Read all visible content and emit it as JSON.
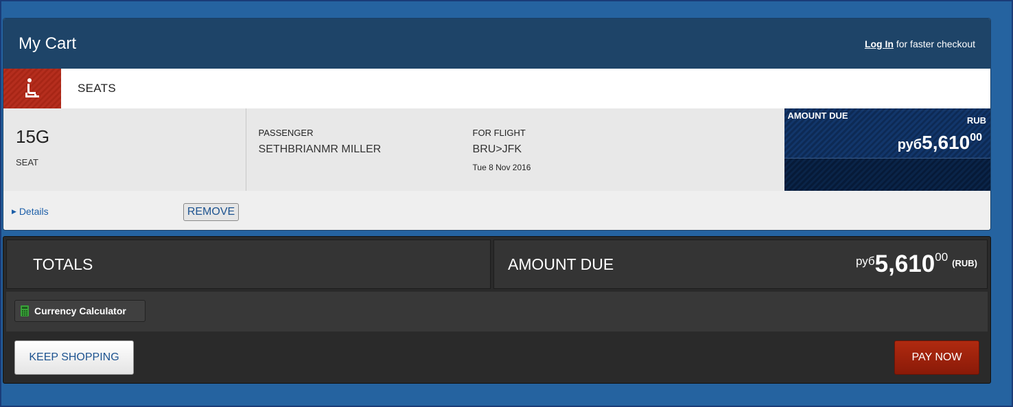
{
  "header": {
    "title": "My Cart",
    "login_link": "Log In",
    "login_suffix": " for faster checkout"
  },
  "section": {
    "icon": "seat-icon",
    "label": "SEATS",
    "accent_color": "#b52e1e"
  },
  "item": {
    "seat_number": "15G",
    "seat_label": "SEAT",
    "passenger_label": "PASSENGER",
    "passenger_name": "SETHBRIANMR MILLER",
    "flight_label": "FOR FLIGHT",
    "flight_route": "BRU>JFK",
    "flight_date": "Tue 8 Nov 2016",
    "amount_label": "AMOUNT DUE",
    "currency_code": "RUB",
    "currency_symbol": "руб",
    "amount_main": "5,610",
    "amount_cents": "00",
    "details_link": "Details",
    "remove_label": "REMOVE"
  },
  "totals": {
    "totals_label": "TOTALS",
    "amount_due_label": "AMOUNT DUE",
    "currency_symbol": "руб",
    "amount_main": "5,610",
    "amount_cents": "00",
    "currency_code": "(RUB)",
    "calculator_label": "Currency Calculator",
    "calculator_icon": "calculator-icon"
  },
  "buttons": {
    "keep_shopping": "KEEP SHOPPING",
    "pay_now": "PAY NOW",
    "pay_color": "#9c2210"
  }
}
